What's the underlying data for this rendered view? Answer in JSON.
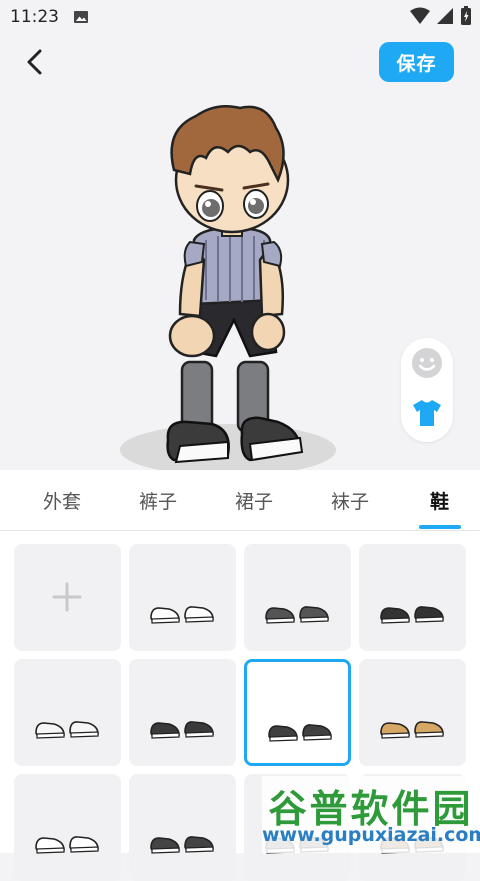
{
  "status_bar": {
    "time": "11:23"
  },
  "header": {
    "save_label": "保存"
  },
  "colors": {
    "accent": "#1fa8f4"
  },
  "mode_switch": {
    "icons": [
      "face-icon",
      "shirt-icon"
    ]
  },
  "tabs": [
    {
      "label": "外套",
      "active": false
    },
    {
      "label": "裤子",
      "active": false
    },
    {
      "label": "裙子",
      "active": false
    },
    {
      "label": "袜子",
      "active": false
    },
    {
      "label": "鞋",
      "active": true
    }
  ],
  "items": [
    {
      "kind": "add"
    },
    {
      "kind": "shoe",
      "color": "#ffffff"
    },
    {
      "kind": "shoe",
      "color": "#555555"
    },
    {
      "kind": "shoe",
      "color": "#333333"
    },
    {
      "kind": "shoe",
      "color": "#f7f7f7"
    },
    {
      "kind": "shoe",
      "color": "#3a3a3a"
    },
    {
      "kind": "shoe",
      "color": "#404040",
      "selected": true
    },
    {
      "kind": "shoe",
      "color": "#d7a865"
    },
    {
      "kind": "shoe",
      "color": "#ffffff"
    },
    {
      "kind": "shoe",
      "color": "#444444"
    },
    {
      "kind": "shoe",
      "color": "#777777"
    },
    {
      "kind": "shoe",
      "color": "#8a6a3c"
    }
  ],
  "watermark": {
    "title": "谷普软件园",
    "url": "www.gupuxiazai.com"
  }
}
